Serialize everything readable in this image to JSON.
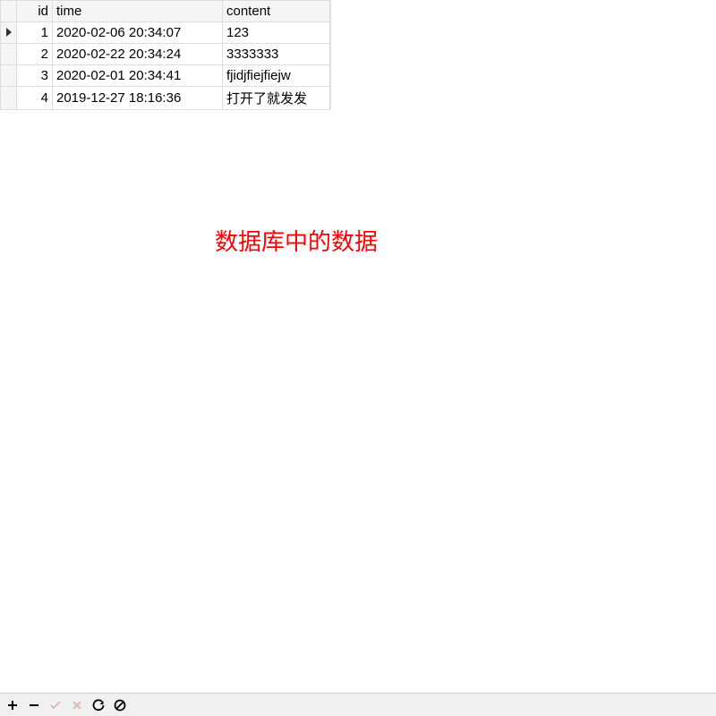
{
  "grid": {
    "columns": {
      "id": "id",
      "time": "time",
      "content": "content"
    },
    "rows": [
      {
        "id": "1",
        "time": "2020-02-06 20:34:07",
        "content": "123",
        "selected": true
      },
      {
        "id": "2",
        "time": "2020-02-22 20:34:24",
        "content": "3333333",
        "selected": false
      },
      {
        "id": "3",
        "time": "2020-02-01 20:34:41",
        "content": "fjidjfiejfiejw",
        "selected": false
      },
      {
        "id": "4",
        "time": "2019-12-27 18:16:36",
        "content": "打开了就发发",
        "selected": false
      }
    ]
  },
  "caption": "数据库中的数据",
  "toolbar": {
    "add": "+",
    "remove": "−",
    "post": "✓",
    "cancel": "×",
    "refresh": "↻",
    "stop": "⊘"
  }
}
